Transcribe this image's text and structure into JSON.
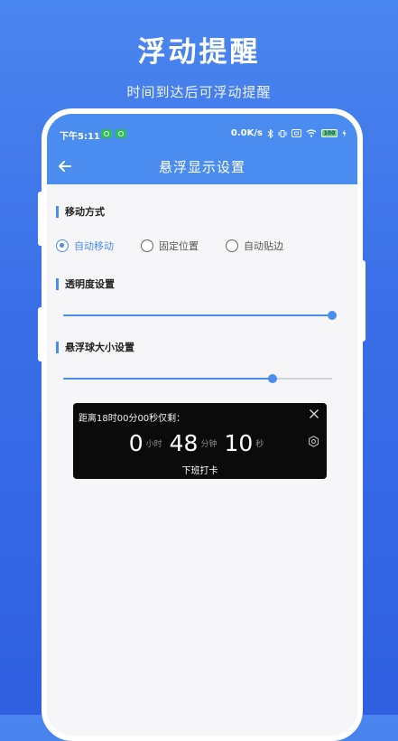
{
  "promo": {
    "title": "浮动提醒",
    "subtitle": "时间到达后可浮动提醒"
  },
  "status_bar": {
    "time": "下午5:11",
    "net_speed": "0.0K/s",
    "battery": "100"
  },
  "nav": {
    "title": "悬浮显示设置"
  },
  "move_mode": {
    "label": "移动方式",
    "options": [
      "自动移动",
      "固定位置",
      "自动贴边"
    ],
    "selected": 0
  },
  "opacity": {
    "label": "透明度设置",
    "value_fraction": 1.0
  },
  "ball_size": {
    "label": "悬浮球大小设置",
    "value_fraction": 0.78
  },
  "floating_card": {
    "heading": "距离18时00分00秒仅剩：",
    "hours": "0",
    "hours_unit": "小时",
    "minutes": "48",
    "minutes_unit": "分钟",
    "seconds": "10",
    "seconds_unit": "秒",
    "footer": "下班打卡"
  },
  "colors": {
    "accent": "#4a8cf0",
    "background_gradient_top": "#4a86ef",
    "card": "#0b0b0b"
  }
}
